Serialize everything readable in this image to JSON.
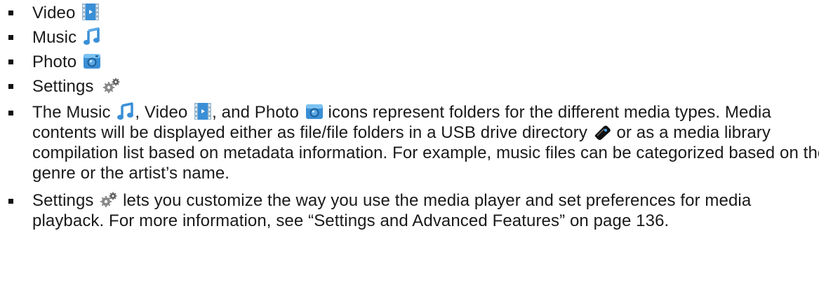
{
  "list": {
    "items": [
      {
        "label": "Video",
        "icon": "video-icon"
      },
      {
        "label": "Music",
        "icon": "music-icon"
      },
      {
        "label": "Photo",
        "icon": "photo-icon"
      },
      {
        "label": "Settings",
        "icon": "settings-icon"
      }
    ],
    "para1": {
      "part1": "The Music ",
      "part2": ", Video ",
      "part3": ", and Photo ",
      "part4": " icons represent folders for the different media types. Media contents will be displayed either as file/file folders in a USB drive directory ",
      "part5": " or as a media library compilation list based on metadata information. For example, music files can be categorized based on their genre or the artist’s name."
    },
    "para2": {
      "part1": "Settings ",
      "part2": " lets you customize the way you use the media player and set preferences for media playback. For more information, see “Settings and Advanced Features” on page 136."
    }
  },
  "colors": {
    "icon_blue": "#3a8fd6",
    "icon_blue_light": "#7cc3f2",
    "icon_gray": "#8a8a8a",
    "icon_dark": "#222222",
    "text": "#1a1a1a"
  }
}
